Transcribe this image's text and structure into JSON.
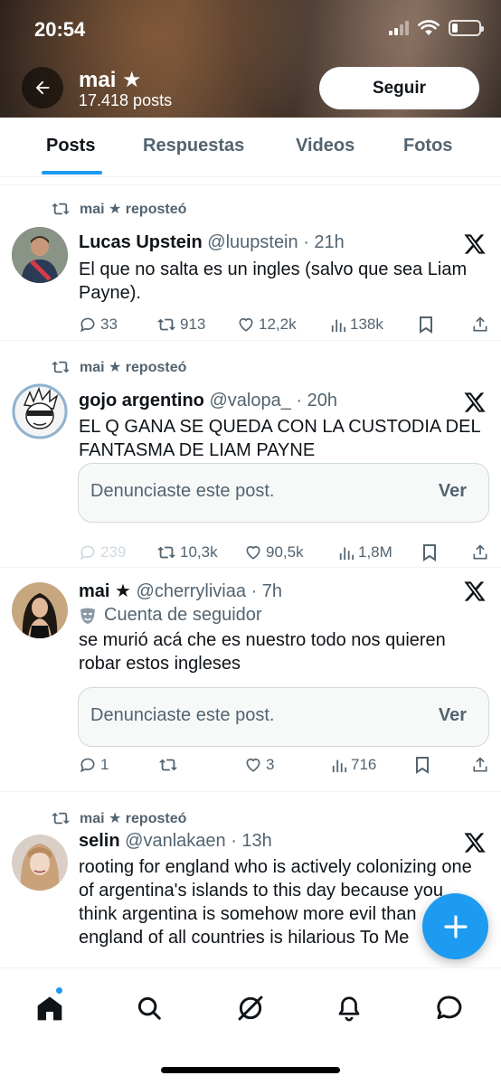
{
  "status_bar": {
    "time": "20:54"
  },
  "header": {
    "profile_name": "mai ★",
    "posts_count": "17.418 posts",
    "follow_label": "Seguir"
  },
  "tabs": [
    {
      "label": "Posts",
      "active": true
    },
    {
      "label": "Respuestas",
      "active": false
    },
    {
      "label": "Videos",
      "active": false
    },
    {
      "label": "Fotos",
      "active": false
    }
  ],
  "tweets": [
    {
      "repost_label": "mai ★ reposteó",
      "name": "Lucas Upstein",
      "handle": "@luupstein",
      "time": "· 21h",
      "text": "El que no salta es un ingles (salvo que sea Liam Payne).",
      "replies": "33",
      "reposts": "913",
      "likes": "12,2k",
      "views": "138k"
    },
    {
      "repost_label": "mai ★ reposteó",
      "name": "gojo argentino",
      "handle": "@valopa_",
      "time": "· 20h",
      "text": "EL Q GANA SE QUEDA CON LA CUSTODIA DEL FANTASMA DE LIAM PAYNE",
      "reported_message": "Denunciaste este post.",
      "reported_action": "Ver",
      "replies": "239",
      "reposts": "10,3k",
      "likes": "90,5k",
      "views": "1,8M"
    },
    {
      "name": "mai ★",
      "handle": "@cherryliviaa",
      "time": "· 7h",
      "account_label": "Cuenta de seguidor",
      "text": "se murió acá che es nuestro todo nos quieren robar estos ingleses",
      "reported_message": "Denunciaste este post.",
      "reported_action": "Ver",
      "replies": "1",
      "reposts": "",
      "likes": "3",
      "views": "716"
    },
    {
      "repost_label": "mai ★ reposteó",
      "name": "selin",
      "handle": "@vanlakaen",
      "time": "· 13h",
      "text": "rooting for england who is actively colonizing one of argentina's islands to this day because you think argentina is somehow more evil than england of all countries is hilarious To Me"
    }
  ],
  "colors": {
    "accent": "#1d9bf0",
    "text_primary": "#0f1419",
    "text_secondary": "#536471"
  }
}
